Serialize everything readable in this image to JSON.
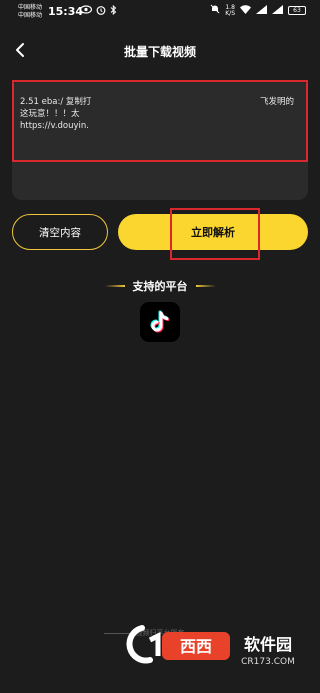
{
  "status_bar": {
    "carrier_1": "中国移动",
    "carrier_2": "中国移动",
    "time": "15:34",
    "net_speed_value": "1.8",
    "net_speed_unit": "K/S",
    "battery": "63"
  },
  "header": {
    "title": "批量下载视频"
  },
  "input": {
    "line1_left": "2.51 eba:/ 复制打",
    "line1_right": "飞发明的",
    "line2": "这玩意！！！太",
    "line3": "https://v.douyin."
  },
  "buttons": {
    "clear_label": "清空内容",
    "parse_label": "立即解析"
  },
  "platforms": {
    "heading": "支持的平台",
    "items": [
      "tiktok-icon"
    ]
  },
  "footer": {
    "text": "视频归平台所有"
  },
  "watermark": {
    "text_1": "西西软件园",
    "text_2": "CR173.COM"
  },
  "colors": {
    "background": "#1c1c1c",
    "accent": "#fbd62e",
    "highlight": "#d9292e"
  }
}
